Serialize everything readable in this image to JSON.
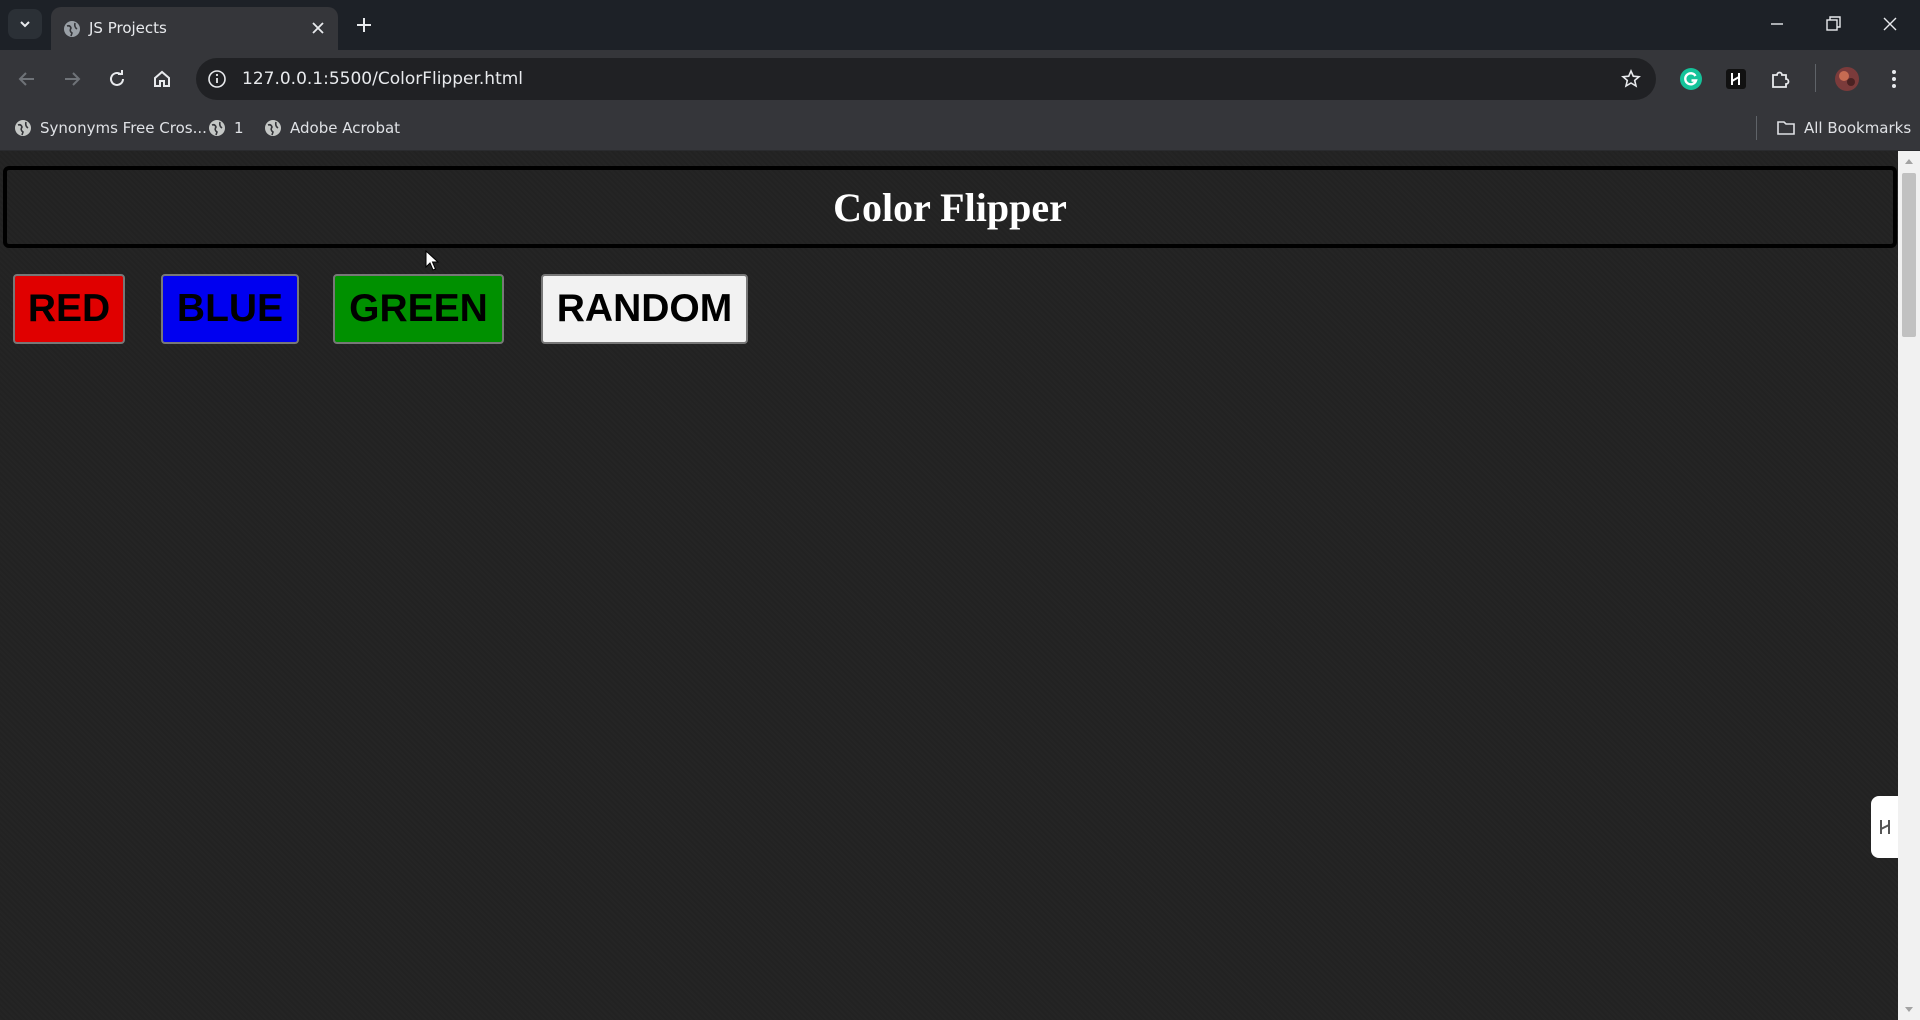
{
  "browser": {
    "tab": {
      "title": "JS Projects"
    },
    "url": "127.0.0.1:5500/ColorFlipper.html",
    "bookmarks": [
      {
        "label": "Synonyms Free Cros...",
        "icon": "globe-icon"
      },
      {
        "label": "1",
        "icon": "globe-icon"
      },
      {
        "label": "Adobe Acrobat",
        "icon": "globe-icon"
      }
    ],
    "all_bookmarks_label": "All Bookmarks"
  },
  "page": {
    "title": "Color Flipper",
    "buttons": [
      {
        "label": "RED",
        "color": "#e00000"
      },
      {
        "label": "BLUE",
        "color": "#0000f0"
      },
      {
        "label": "GREEN",
        "color": "#009000"
      },
      {
        "label": "RANDOM",
        "color": "#f2f2f2"
      }
    ]
  },
  "colors": {
    "page_background": "#222222",
    "header_border": "#000000",
    "title_text": "#ffffff"
  }
}
